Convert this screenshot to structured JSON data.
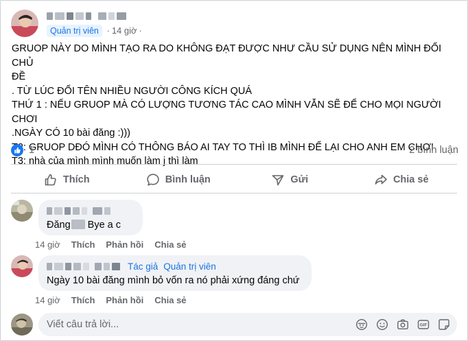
{
  "post": {
    "role_badge": "Quản trị viên",
    "time": "14 giờ",
    "separator": "·",
    "lines": [
      "GRUOP NÀY DO MÌNH TẠO RA DO KHÔNG ĐẠT ĐƯỢC NHƯ CẦU SỬ DỤNG NÊN MÌNH ĐỔI CHỦ",
      "ĐỀ",
      ". TỪ LÚC ĐỔI TÊN NHIỀU NGƯỜI CÔNG KÍCH QUÁ",
      "THỨ 1 : NẾU GRUOP MÀ CÓ LƯỢNG TƯƠNG TÁC CAO MÌNH VẪN SẼ ĐỂ CHO MỌI NGƯỜI CHƠI",
      ".NGÀY CÓ 10 bài đăng :)))",
      "T2: GRUOP DĐÓ MÌNH CÓ THÔNG BÁO AI TAY TO THÌ IB MÌNH ĐỂ LẠI CHO ANH EM CHƠI",
      "T3: nhà của mình mình muốn làm j thì làm"
    ],
    "reaction_count": "1",
    "comment_count": "2 bình luận"
  },
  "actions": {
    "like": "Thích",
    "comment": "Bình luận",
    "send": "Gửi",
    "share": "Chia sẻ"
  },
  "comments": [
    {
      "text_before": "Đăng",
      "text_after": "Bye a c",
      "time": "14 giờ",
      "like": "Thích",
      "reply": "Phản hồi",
      "share": "Chia sẻ"
    },
    {
      "role_author": "Tác giả",
      "role_admin": "Quản trị viên",
      "text": "Ngày 10 bài đăng mình bỏ vốn ra nó phải xứng đáng chứ",
      "time": "14 giờ",
      "like": "Thích",
      "reply": "Phản hồi",
      "share": "Chia sẻ"
    }
  ],
  "reply": {
    "placeholder": "Viết câu trả lời...",
    "icons": [
      "avatar-sticker-icon",
      "emoji-icon",
      "camera-icon",
      "gif-icon",
      "sticker-icon"
    ]
  },
  "colors": {
    "accent": "#1877f2",
    "muted_text": "#65676b",
    "bubble": "#f0f2f5",
    "badge_bg": "#e7f3ff"
  }
}
